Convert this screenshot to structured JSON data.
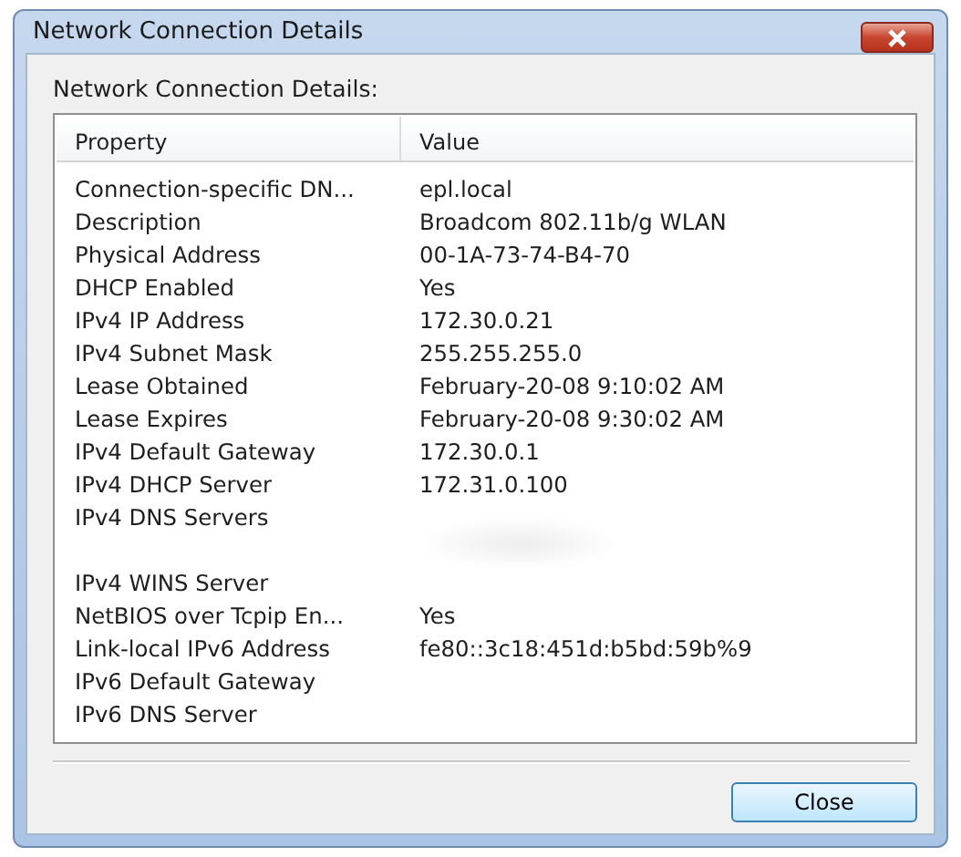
{
  "window": {
    "title": "Network Connection Details"
  },
  "label": "Network Connection Details:",
  "table": {
    "columns": [
      "Property",
      "Value"
    ],
    "rows": [
      {
        "kind": "text",
        "property": "Connection-specific DN...",
        "value": "epl.local"
      },
      {
        "kind": "text",
        "property": "Description",
        "value": "Broadcom 802.11b/g WLAN"
      },
      {
        "kind": "text",
        "property": "Physical Address",
        "value": "00-1A-73-74-B4-70"
      },
      {
        "kind": "text",
        "property": "DHCP Enabled",
        "value": "Yes"
      },
      {
        "kind": "text",
        "property": "IPv4 IP Address",
        "value": "172.30.0.21"
      },
      {
        "kind": "text",
        "property": "IPv4 Subnet Mask",
        "value": "255.255.255.0"
      },
      {
        "kind": "text",
        "property": "Lease Obtained",
        "value": "February-20-08 9:10:02 AM"
      },
      {
        "kind": "text",
        "property": "Lease Expires",
        "value": "February-20-08 9:30:02 AM"
      },
      {
        "kind": "text",
        "property": "IPv4 Default Gateway",
        "value": "172.30.0.1"
      },
      {
        "kind": "text",
        "property": "IPv4 DHCP Server",
        "value": "172.31.0.100"
      },
      {
        "kind": "redacted",
        "property": "IPv4 DNS Servers"
      },
      {
        "kind": "text",
        "property": "IPv4 WINS Server"
      },
      {
        "kind": "text",
        "property": "NetBIOS over Tcpip En...",
        "value": "Yes"
      },
      {
        "kind": "text",
        "property": "Link-local IPv6 Address",
        "value": "fe80::3c18:451d:b5bd:59b%9"
      },
      {
        "kind": "text",
        "property": "IPv6 Default Gateway"
      },
      {
        "kind": "text",
        "property": "IPv6 DNS Server"
      }
    ]
  },
  "buttons": [
    "Close"
  ]
}
